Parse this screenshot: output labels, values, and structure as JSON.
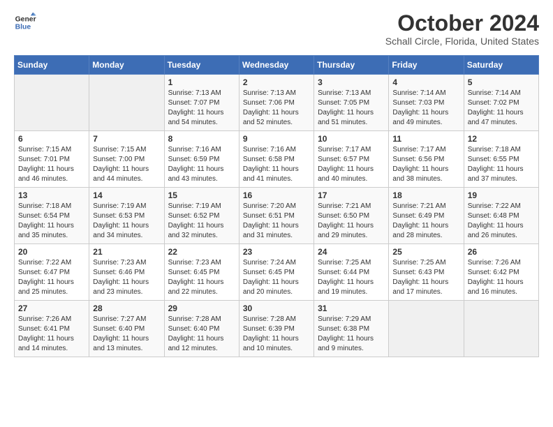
{
  "header": {
    "logo_line1": "General",
    "logo_line2": "Blue",
    "month": "October 2024",
    "location": "Schall Circle, Florida, United States"
  },
  "weekdays": [
    "Sunday",
    "Monday",
    "Tuesday",
    "Wednesday",
    "Thursday",
    "Friday",
    "Saturday"
  ],
  "weeks": [
    [
      {
        "day": "",
        "info": ""
      },
      {
        "day": "",
        "info": ""
      },
      {
        "day": "1",
        "info": "Sunrise: 7:13 AM\nSunset: 7:07 PM\nDaylight: 11 hours and 54 minutes."
      },
      {
        "day": "2",
        "info": "Sunrise: 7:13 AM\nSunset: 7:06 PM\nDaylight: 11 hours and 52 minutes."
      },
      {
        "day": "3",
        "info": "Sunrise: 7:13 AM\nSunset: 7:05 PM\nDaylight: 11 hours and 51 minutes."
      },
      {
        "day": "4",
        "info": "Sunrise: 7:14 AM\nSunset: 7:03 PM\nDaylight: 11 hours and 49 minutes."
      },
      {
        "day": "5",
        "info": "Sunrise: 7:14 AM\nSunset: 7:02 PM\nDaylight: 11 hours and 47 minutes."
      }
    ],
    [
      {
        "day": "6",
        "info": "Sunrise: 7:15 AM\nSunset: 7:01 PM\nDaylight: 11 hours and 46 minutes."
      },
      {
        "day": "7",
        "info": "Sunrise: 7:15 AM\nSunset: 7:00 PM\nDaylight: 11 hours and 44 minutes."
      },
      {
        "day": "8",
        "info": "Sunrise: 7:16 AM\nSunset: 6:59 PM\nDaylight: 11 hours and 43 minutes."
      },
      {
        "day": "9",
        "info": "Sunrise: 7:16 AM\nSunset: 6:58 PM\nDaylight: 11 hours and 41 minutes."
      },
      {
        "day": "10",
        "info": "Sunrise: 7:17 AM\nSunset: 6:57 PM\nDaylight: 11 hours and 40 minutes."
      },
      {
        "day": "11",
        "info": "Sunrise: 7:17 AM\nSunset: 6:56 PM\nDaylight: 11 hours and 38 minutes."
      },
      {
        "day": "12",
        "info": "Sunrise: 7:18 AM\nSunset: 6:55 PM\nDaylight: 11 hours and 37 minutes."
      }
    ],
    [
      {
        "day": "13",
        "info": "Sunrise: 7:18 AM\nSunset: 6:54 PM\nDaylight: 11 hours and 35 minutes."
      },
      {
        "day": "14",
        "info": "Sunrise: 7:19 AM\nSunset: 6:53 PM\nDaylight: 11 hours and 34 minutes."
      },
      {
        "day": "15",
        "info": "Sunrise: 7:19 AM\nSunset: 6:52 PM\nDaylight: 11 hours and 32 minutes."
      },
      {
        "day": "16",
        "info": "Sunrise: 7:20 AM\nSunset: 6:51 PM\nDaylight: 11 hours and 31 minutes."
      },
      {
        "day": "17",
        "info": "Sunrise: 7:21 AM\nSunset: 6:50 PM\nDaylight: 11 hours and 29 minutes."
      },
      {
        "day": "18",
        "info": "Sunrise: 7:21 AM\nSunset: 6:49 PM\nDaylight: 11 hours and 28 minutes."
      },
      {
        "day": "19",
        "info": "Sunrise: 7:22 AM\nSunset: 6:48 PM\nDaylight: 11 hours and 26 minutes."
      }
    ],
    [
      {
        "day": "20",
        "info": "Sunrise: 7:22 AM\nSunset: 6:47 PM\nDaylight: 11 hours and 25 minutes."
      },
      {
        "day": "21",
        "info": "Sunrise: 7:23 AM\nSunset: 6:46 PM\nDaylight: 11 hours and 23 minutes."
      },
      {
        "day": "22",
        "info": "Sunrise: 7:23 AM\nSunset: 6:45 PM\nDaylight: 11 hours and 22 minutes."
      },
      {
        "day": "23",
        "info": "Sunrise: 7:24 AM\nSunset: 6:45 PM\nDaylight: 11 hours and 20 minutes."
      },
      {
        "day": "24",
        "info": "Sunrise: 7:25 AM\nSunset: 6:44 PM\nDaylight: 11 hours and 19 minutes."
      },
      {
        "day": "25",
        "info": "Sunrise: 7:25 AM\nSunset: 6:43 PM\nDaylight: 11 hours and 17 minutes."
      },
      {
        "day": "26",
        "info": "Sunrise: 7:26 AM\nSunset: 6:42 PM\nDaylight: 11 hours and 16 minutes."
      }
    ],
    [
      {
        "day": "27",
        "info": "Sunrise: 7:26 AM\nSunset: 6:41 PM\nDaylight: 11 hours and 14 minutes."
      },
      {
        "day": "28",
        "info": "Sunrise: 7:27 AM\nSunset: 6:40 PM\nDaylight: 11 hours and 13 minutes."
      },
      {
        "day": "29",
        "info": "Sunrise: 7:28 AM\nSunset: 6:40 PM\nDaylight: 11 hours and 12 minutes."
      },
      {
        "day": "30",
        "info": "Sunrise: 7:28 AM\nSunset: 6:39 PM\nDaylight: 11 hours and 10 minutes."
      },
      {
        "day": "31",
        "info": "Sunrise: 7:29 AM\nSunset: 6:38 PM\nDaylight: 11 hours and 9 minutes."
      },
      {
        "day": "",
        "info": ""
      },
      {
        "day": "",
        "info": ""
      }
    ]
  ]
}
